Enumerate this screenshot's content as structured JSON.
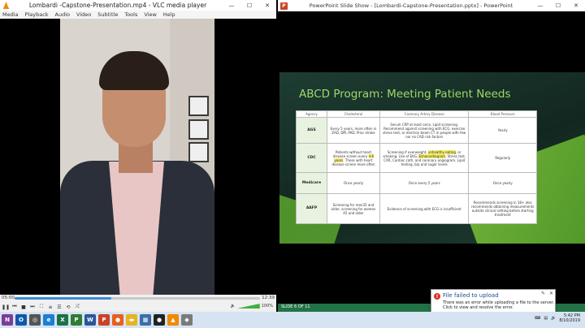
{
  "vlc": {
    "title": "Lombardi -Capstone-Presentation.mp4 - VLC media player",
    "menu": [
      "Media",
      "Playback",
      "Audio",
      "Video",
      "Subtitle",
      "Tools",
      "View",
      "Help"
    ],
    "time_elapsed": "05:00",
    "time_total": "12:39",
    "progress": 0.395,
    "volume": "100%"
  },
  "ppt": {
    "title": "PowerPoint Slide Show - [Lombardi-Capstone-Presentation.pptx] - PowerPoint",
    "status": "SLIDE 6 OF 11",
    "slide": {
      "heading": "ABCD Program: Meeting Patient Needs",
      "columns": [
        "Agency",
        "Cholesterol",
        "Coronary Artery Disease",
        "Blood Pressure"
      ],
      "rows": [
        {
          "agency": "AGS",
          "chol": "Every 5 years, more often in ZAD, DM, PAD, Prior stroke",
          "cad": "Serum CRP at least once, Lipid screening. Recommend against screening with ECG, exercise stress test, or electron beam CT in people with few nor no CAD risk factors",
          "bp": "Yearly"
        },
        {
          "agency": "CDC",
          "chol_pre": "Patients without heart disease screen every ",
          "chol_hl": "4-6 years",
          "chol_post": ". Those with heart disease screen more often",
          "cad_pre": "Screening if overweight, ",
          "cad_hl1": "unhealthy eating",
          "cad_mid": ", or smoking. Use of EKG, ",
          "cad_hl2": "Echocardiogram",
          "cad_post": ", Stress test, CXR, Cardiac cath, and coronary angiogram. Lipid testing, b/p and sugar levels",
          "bp": "Regularly"
        },
        {
          "agency": "Medicare",
          "chol": "Once yearly",
          "cad": "Once every 5 years",
          "bp": "Once yearly"
        },
        {
          "agency": "AAFP",
          "chol": "Screening for men35 and older, screening for women 45 and older",
          "cad": "Evidence of screening with ECG is insufficient",
          "bp": "Recommends screening in 18+ also recommends obtaining measurements outside clinical setting before starting treatment"
        }
      ]
    }
  },
  "toast": {
    "title": "File failed to upload",
    "body": "There was an error while uploading a file to the server. Click to view and resolve the error."
  },
  "taskbar": {
    "apps": [
      {
        "icon": "onenote-icon",
        "letter": "N",
        "color": "#7b3d99"
      },
      {
        "icon": "outlook-icon",
        "letter": "O",
        "color": "#0f5aa8"
      },
      {
        "icon": "media-icon",
        "letter": "◎",
        "color": "#555555"
      },
      {
        "icon": "edge-icon",
        "letter": "e",
        "color": "#1d7fd4"
      },
      {
        "icon": "excel-icon",
        "letter": "X",
        "color": "#1e7145"
      },
      {
        "icon": "project-icon",
        "letter": "P",
        "color": "#2e7d32"
      },
      {
        "icon": "word-icon",
        "letter": "W",
        "color": "#2b579a"
      },
      {
        "icon": "powerpoint-icon",
        "letter": "P",
        "color": "#c94326"
      },
      {
        "icon": "firefox-icon",
        "letter": "●",
        "color": "#e8601c"
      },
      {
        "icon": "folder-icon",
        "letter": "▬",
        "color": "#e6b422"
      },
      {
        "icon": "app-icon",
        "letter": "▦",
        "color": "#3b6ea5"
      },
      {
        "icon": "record-icon",
        "letter": "●",
        "color": "#222222"
      },
      {
        "icon": "vlc-icon",
        "letter": "▲",
        "color": "#f08a00"
      },
      {
        "icon": "app2-icon",
        "letter": "◆",
        "color": "#7a7a7a"
      }
    ],
    "time": "5:42 PM",
    "date": "8/10/2019"
  }
}
